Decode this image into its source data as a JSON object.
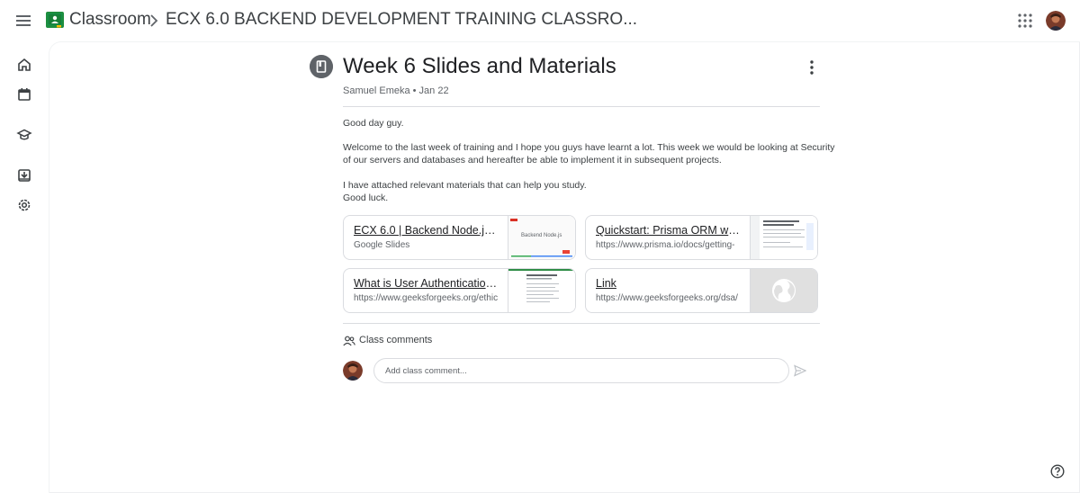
{
  "header": {
    "app_title": "Classroom",
    "class_title": "ECX 6.0 BACKEND DEVELOPMENT TRAINING CLASSRO..."
  },
  "icons": {
    "menu": "hamburger-menu-icon",
    "logo": "classroom-logo-icon",
    "breadcrumb": "chevron-right-icon",
    "apps": "apps-grid-icon",
    "rail": [
      "home-icon",
      "calendar-icon",
      "enrolled-classes-icon",
      "archived-classes-icon",
      "settings-icon"
    ],
    "post": "material-book-icon",
    "more": "more-vertical-icon",
    "comments": "people-icon",
    "send": "send-icon",
    "help": "help-icon"
  },
  "post": {
    "title": "Week 6 Slides and Materials",
    "meta": "Samuel Emeka • Jan 22",
    "body": [
      "Good day guy.",
      "Welcome to the last week of training and I hope you guys have learnt a lot. This week we would be looking at Security",
      "of our servers and databases and hereafter be able to implement it in subsequent projects.",
      "I have attached relevant materials that can help you study.",
      "Good luck."
    ]
  },
  "attachments": [
    {
      "title": "ECX 6.0 | Backend Node.js | ...",
      "subtitle": "Google Slides",
      "thumb_text": "Backend Node.js"
    },
    {
      "title": "Quickstart: Prisma ORM with...",
      "subtitle": "https://www.prisma.io/docs/getting-"
    },
    {
      "title": "What is User Authentication, ...",
      "subtitle": "https://www.geeksforgeeks.org/ethic"
    },
    {
      "title": "Link",
      "subtitle": "https://www.geeksforgeeks.org/dsa/"
    }
  ],
  "comments": {
    "label": "Class comments",
    "placeholder": "Add class comment..."
  },
  "colors": {
    "accent_green": "#1e8e3e",
    "logo_yellow": "#fbbc04",
    "text_primary": "#202124",
    "text_secondary": "#5f6368",
    "border": "#dadce0"
  }
}
